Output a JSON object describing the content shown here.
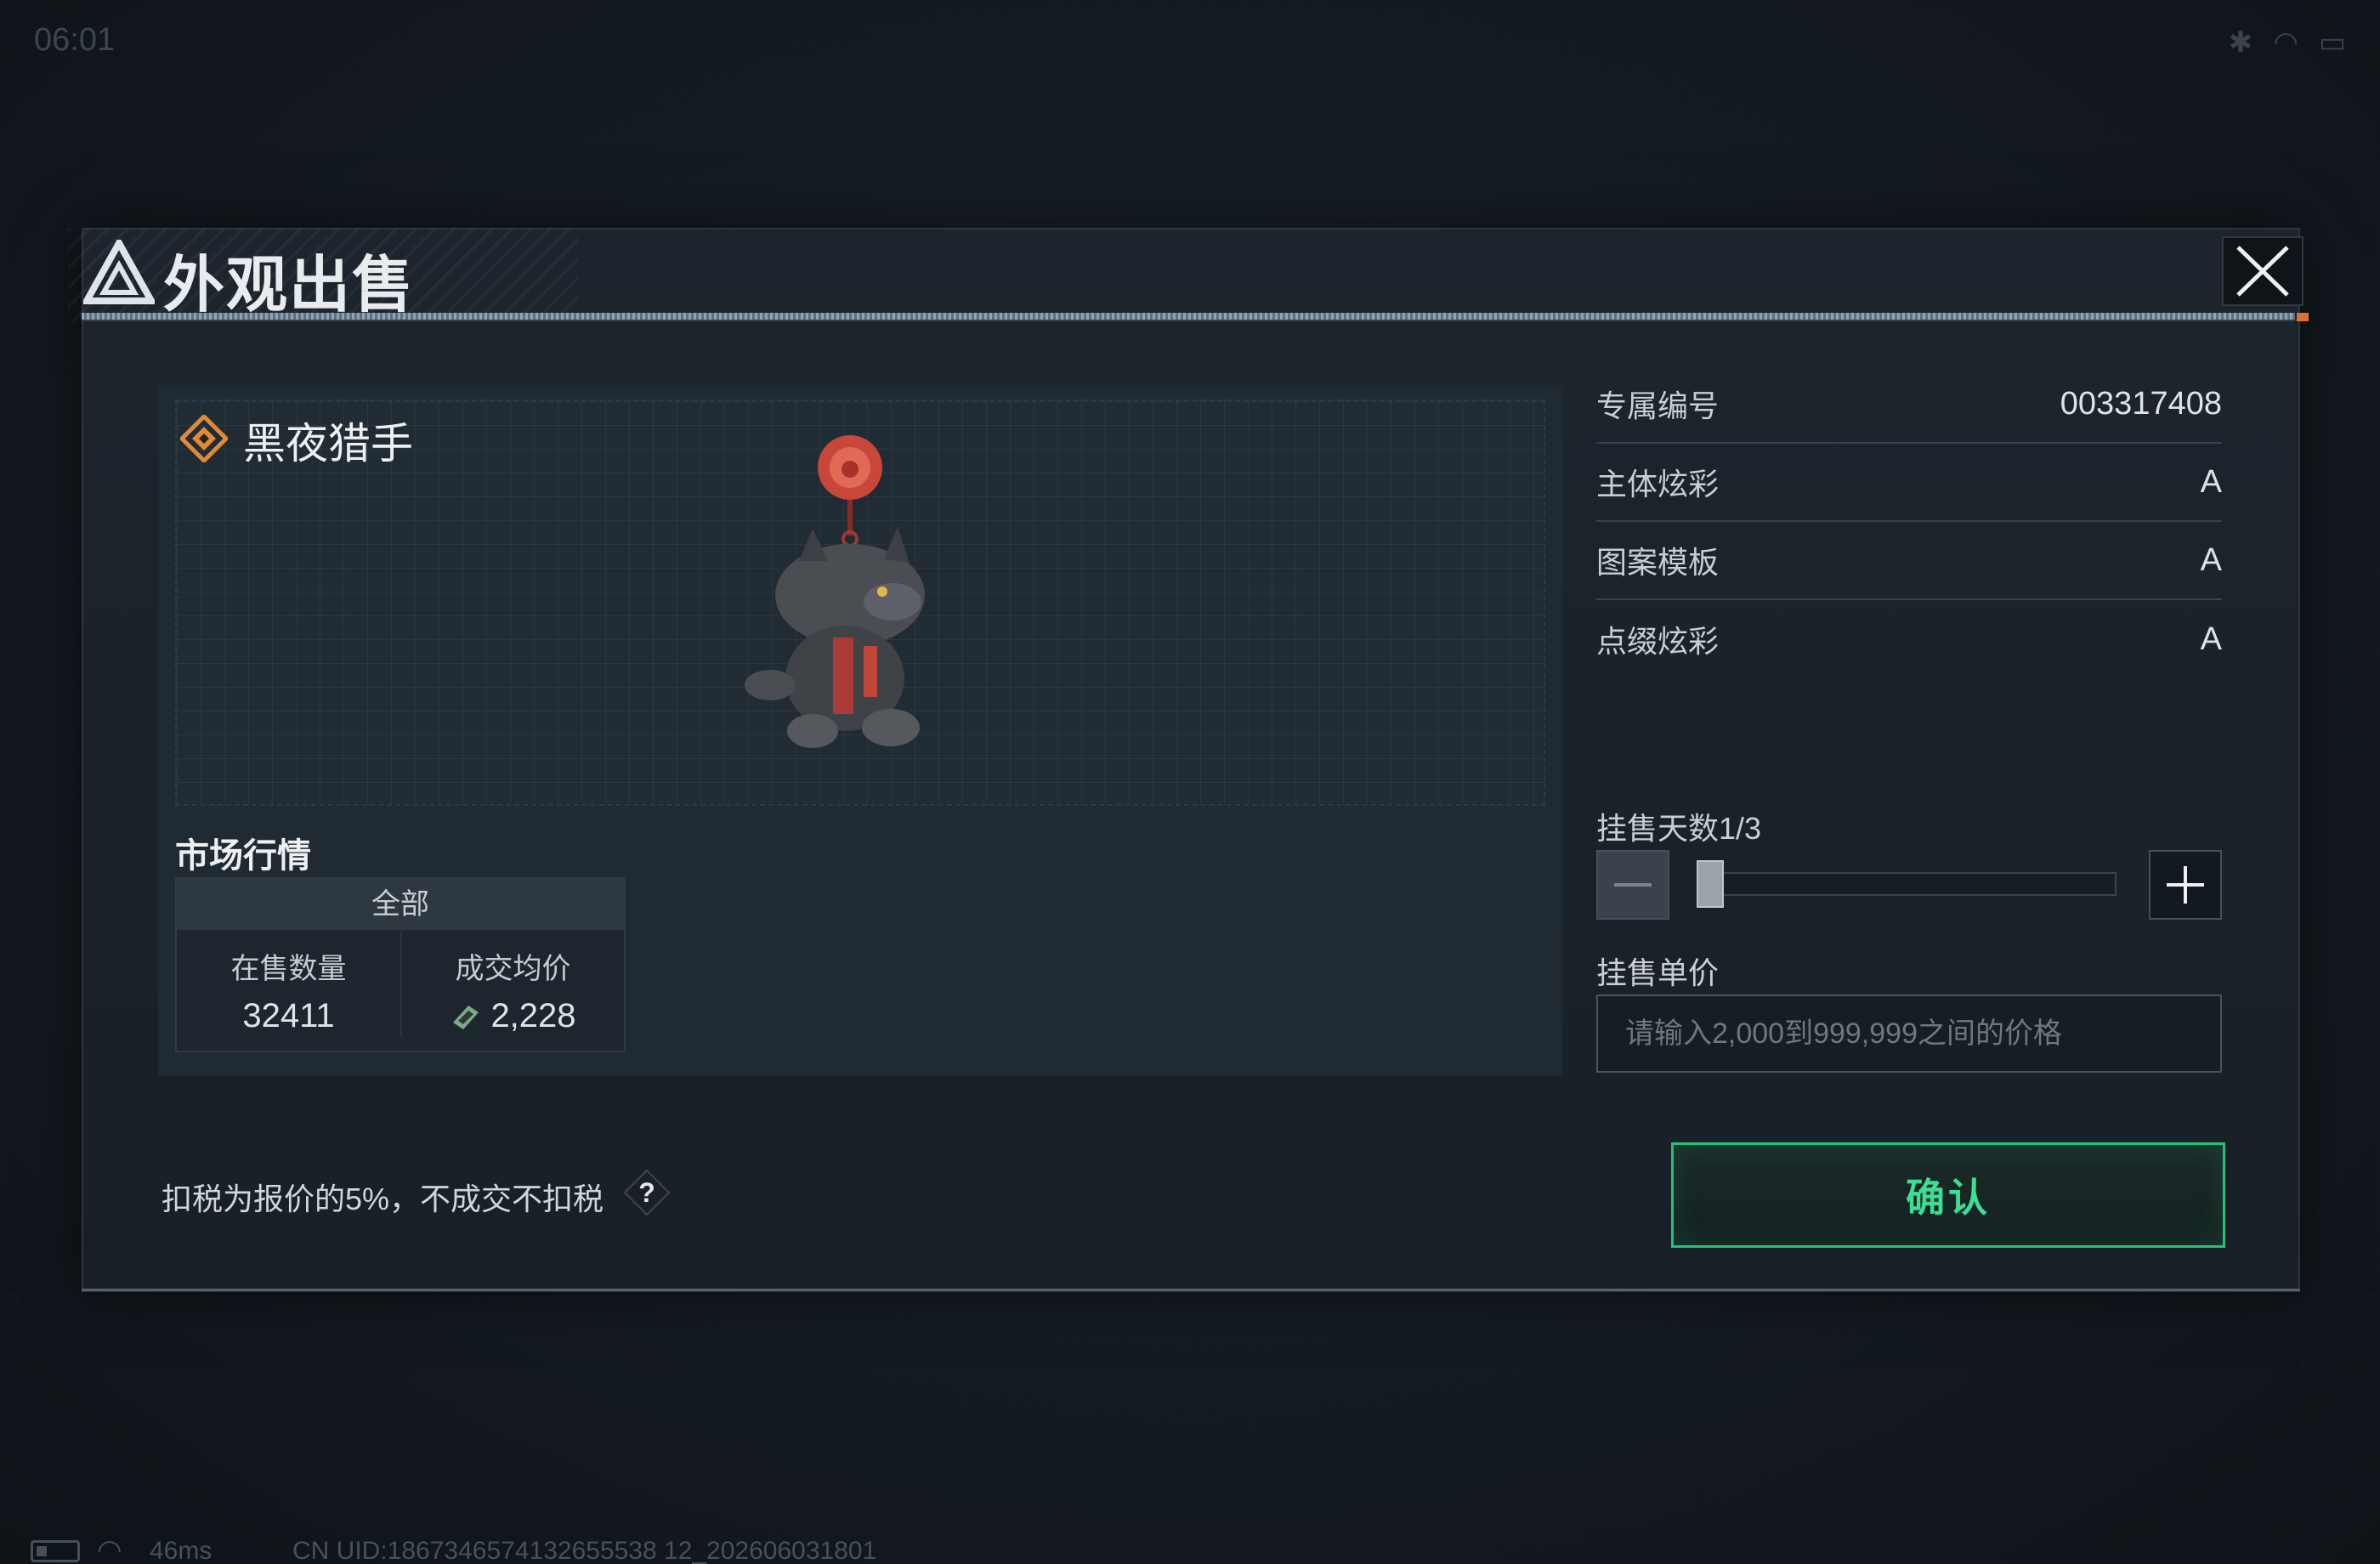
{
  "status_bar": {
    "time": "06:01",
    "icons": [
      "bluetooth-icon",
      "wifi-icon",
      "battery-icon"
    ]
  },
  "dialog": {
    "title": "外观出售",
    "close_icon": "close-icon"
  },
  "item": {
    "name": "黑夜猎手",
    "rarity_icon": "diamond-rarity-icon"
  },
  "market": {
    "title": "市场行情",
    "tab": "全部",
    "on_sale_label": "在售数量",
    "on_sale_value": "32411",
    "avg_price_label": "成交均价",
    "avg_price_value": "2,228"
  },
  "attributes": [
    {
      "label": "专属编号",
      "value": "003317408"
    },
    {
      "label": "主体炫彩",
      "value": "A"
    },
    {
      "label": "图案模板",
      "value": "A"
    },
    {
      "label": "点缀炫彩",
      "value": "A"
    }
  ],
  "listing": {
    "days_label": "挂售天数1/3",
    "days_current": 1,
    "days_max": 3,
    "price_label": "挂售单价",
    "price_placeholder": "请输入2,000到999,999之间的价格",
    "price_value": ""
  },
  "footer_note": {
    "tax_text": "扣税为报价的5%，不成交不扣税",
    "help_symbol": "?"
  },
  "confirm_label": "确认",
  "footer": {
    "ping": "46ms",
    "uid": "CN UID:1867346574132655538 12_202606031801"
  },
  "colors": {
    "accent_green": "#21c27a",
    "accent_orange": "#e0702a",
    "background": "#151c23"
  }
}
